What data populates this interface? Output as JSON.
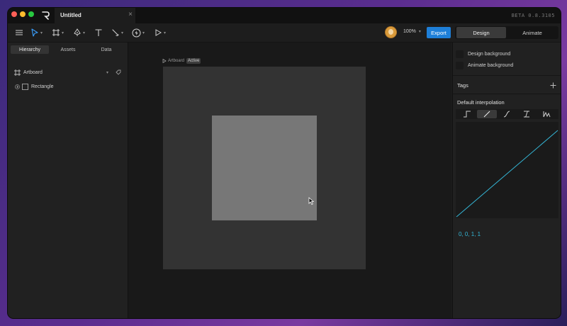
{
  "window": {
    "doc_tab": {
      "title": "Untitled"
    },
    "version": "BETA 0.8.3105"
  },
  "toolbar": {
    "tools": [
      "menu-icon",
      "select-icon",
      "frame-icon",
      "pen-icon",
      "text-icon",
      "brush-icon",
      "bolt-icon",
      "play-icon"
    ],
    "zoom": "100%",
    "export_label": "Export",
    "modes": {
      "design": "Design",
      "animate": "Animate",
      "active": "design"
    }
  },
  "left_panel": {
    "tabs": [
      {
        "label": "Hierarchy",
        "active": true
      },
      {
        "label": "Assets",
        "active": false
      },
      {
        "label": "Data",
        "active": false
      }
    ],
    "tree": {
      "artboard": "Artboard",
      "children": [
        {
          "label": "Rectangle"
        }
      ]
    }
  },
  "canvas": {
    "artboard_label": "Artboard",
    "status_badge": "Active"
  },
  "right_panel": {
    "background_rows": [
      {
        "label": "Design background"
      },
      {
        "label": "Animate background"
      }
    ],
    "tags_title": "Tags",
    "interpolation_title": "Default interpolation",
    "interpolation_types": [
      "hold",
      "linear",
      "cubic",
      "elastic",
      "custom"
    ],
    "active_interpolation": "linear",
    "curve_values": "0, 0, 1, 1"
  },
  "colors": {
    "accent": "#1e7fd8",
    "curve": "#34b6d6",
    "artboard": "#333333",
    "rectangle": "#777777"
  }
}
